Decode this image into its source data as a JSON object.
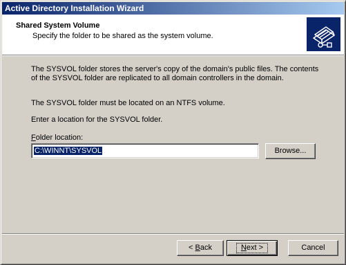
{
  "window": {
    "title": "Active Directory Installation Wizard"
  },
  "header": {
    "title": "Shared System Volume",
    "subtitle": "Specify the folder to be shared as the system volume.",
    "icon": "sysvol-wizard-icon"
  },
  "body": {
    "paragraph1_line1": "The SYSVOL folder stores the server's copy of the domain's public files. The contents",
    "paragraph1_line2": "of the SYSVOL folder are replicated to all domain controllers in the domain.",
    "paragraph2": "The SYSVOL folder must be located on an NTFS volume.",
    "paragraph3": "Enter a location for the SYSVOL folder.",
    "folder_label_prefix": "F",
    "folder_label_rest": "older location:",
    "folder_value": "C:\\WINNT\\SYSVOL",
    "browse_label": "Browse..."
  },
  "footer": {
    "back_prefix": "< ",
    "back_accel": "B",
    "back_rest": "ack",
    "next_accel": "N",
    "next_rest": "ext >",
    "cancel_label": "Cancel"
  },
  "colors": {
    "titlebar_start": "#0a246a",
    "titlebar_end": "#a6caf0",
    "dialog_face": "#d4d0c8",
    "selection": "#0a246a"
  }
}
